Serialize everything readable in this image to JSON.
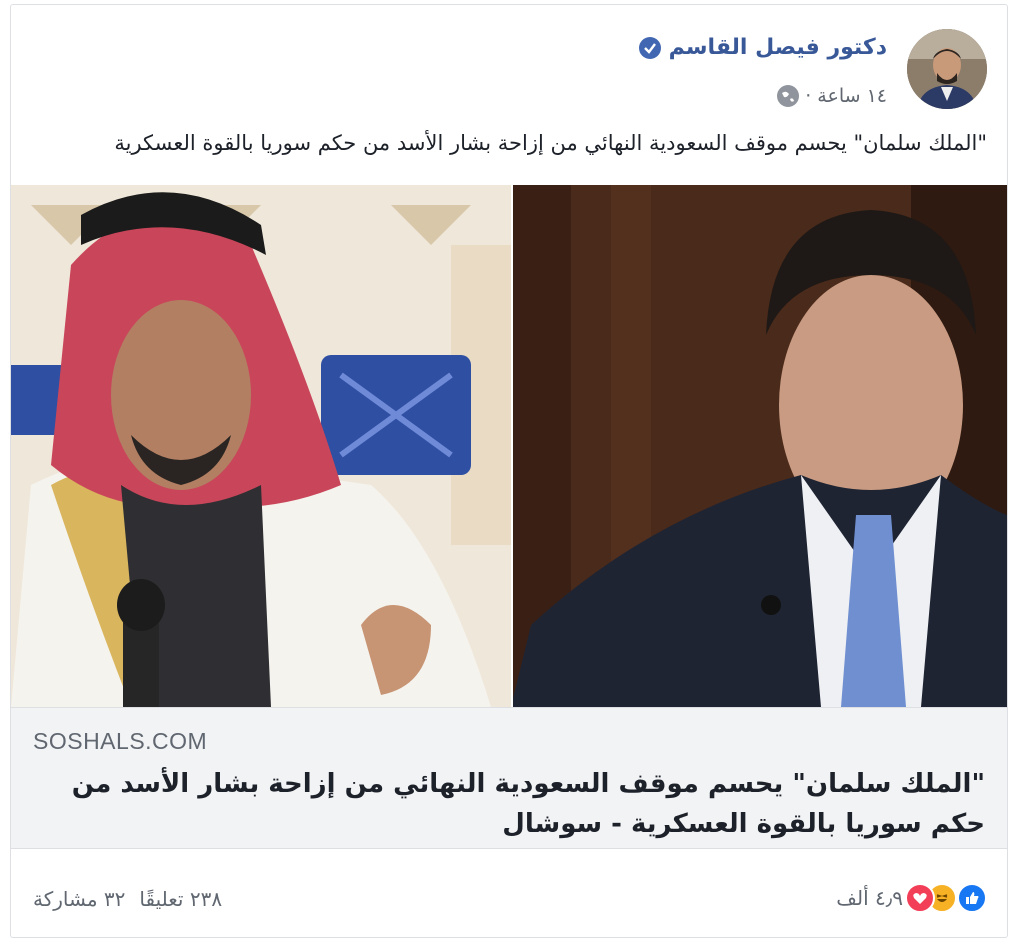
{
  "post": {
    "author": "دكتور فيصل القاسم",
    "time": "١٤ ساعة",
    "separator": "·",
    "text": "\"الملك سلمان\" يحسم موقف السعودية النهائي من إزاحة بشار الأسد من حكم سوريا بالقوة العسكرية"
  },
  "link": {
    "domain": "SOSHALS.COM",
    "title": "\"الملك سلمان\" يحسم موقف السعودية النهائي من إزاحة بشار الأسد من حكم سوريا بالقوة العسكرية - سوشال"
  },
  "footer": {
    "reaction_count": "٤٫٩ ألف",
    "comments": "٢٣٨ تعليقًا",
    "shares": "٣٢ مشاركة"
  },
  "colors": {
    "accent": "#385898",
    "like": "#1877f2",
    "haha": "#f7b125",
    "love": "#f33e58"
  }
}
